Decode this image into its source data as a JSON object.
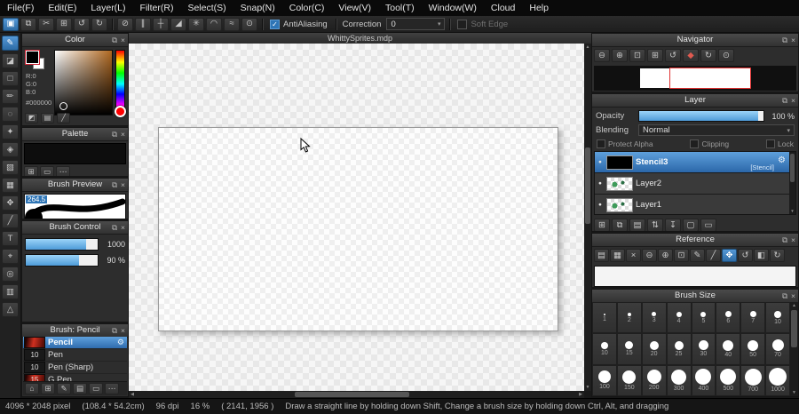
{
  "ui": {
    "popout": "⧉",
    "close": "×",
    "caret": "▾",
    "up": "▲",
    "down": "▼",
    "left": "◀",
    "right": "▶",
    "eye": "●",
    "gear": "⚙",
    "check": "✓",
    "dots": "⋯"
  },
  "colors": {
    "accent": "#2e75b6",
    "selection": "#3f87c9",
    "foreground": "#000000"
  },
  "menu_bar": {
    "items": [
      "File(F)",
      "Edit(E)",
      "Layer(L)",
      "Filter(R)",
      "Select(S)",
      "Snap(N)",
      "Color(C)",
      "View(V)",
      "Tool(T)",
      "Window(W)",
      "Cloud",
      "Help"
    ]
  },
  "top_toolbar": {
    "left_icons": [
      {
        "name": "selection-mode-icon",
        "glyph": "▣",
        "selected": true
      },
      {
        "name": "paste-icon",
        "glyph": "⧉"
      },
      {
        "name": "cut-icon",
        "glyph": "✂"
      },
      {
        "name": "copy-icon",
        "glyph": "⊞"
      },
      {
        "name": "undo-icon",
        "glyph": "↺"
      },
      {
        "name": "redo-icon",
        "glyph": "↻"
      }
    ],
    "snap_icons": [
      {
        "name": "snap-off-icon",
        "glyph": "⊘"
      },
      {
        "name": "snap-parallel-icon",
        "glyph": "∥"
      },
      {
        "name": "snap-crosshatch-icon",
        "glyph": "┼"
      },
      {
        "name": "snap-vanishing-point-icon",
        "glyph": "◢"
      },
      {
        "name": "snap-radial-icon",
        "glyph": "✳"
      },
      {
        "name": "snap-ellipse-icon",
        "glyph": "◠"
      },
      {
        "name": "snap-curve-icon",
        "glyph": "≈"
      },
      {
        "name": "snap-settings-icon",
        "glyph": "⊙"
      }
    ],
    "antialiasing_label": "AntiAliasing",
    "correction_label": "Correction",
    "correction_value": "0",
    "soft_edge_label": "Soft Edge"
  },
  "tool_strip": {
    "tools": [
      {
        "name": "brush-tool",
        "glyph": "✎",
        "selected": true
      },
      {
        "name": "eraser-tool",
        "glyph": "◪"
      },
      {
        "name": "select-rect-tool",
        "glyph": "□"
      },
      {
        "name": "select-pen-tool",
        "glyph": "✏"
      },
      {
        "name": "lasso-tool",
        "glyph": "◌"
      },
      {
        "name": "magic-wand-tool",
        "glyph": "✦"
      },
      {
        "name": "bucket-fill-tool",
        "glyph": "◈"
      },
      {
        "name": "gradient-tool",
        "glyph": "▨"
      },
      {
        "name": "pixel-grid-tool",
        "glyph": "▦"
      },
      {
        "name": "move-tool",
        "glyph": "✥"
      },
      {
        "name": "eyedropper-tool",
        "glyph": "╱"
      },
      {
        "name": "text-tool",
        "glyph": "T"
      },
      {
        "name": "pan-tool",
        "glyph": "⌖"
      },
      {
        "name": "zoom-tool",
        "glyph": "◎"
      },
      {
        "name": "divide-tool",
        "glyph": "▥"
      },
      {
        "name": "shape-tool",
        "glyph": "△"
      }
    ]
  },
  "document": {
    "title": "WhittySprites.mdp"
  },
  "panels": {
    "color": {
      "title": "Color",
      "r": "R:0",
      "g": "G:0",
      "b": "B:0",
      "hex": "#000000",
      "foot_icons": [
        {
          "name": "swatch-pair-icon",
          "glyph": "◩"
        },
        {
          "name": "slider-view-icon",
          "glyph": "▤"
        },
        {
          "name": "line-preview-icon",
          "glyph": "╱"
        }
      ]
    },
    "palette": {
      "title": "Palette",
      "toolbar_icons": [
        {
          "name": "add-color-icon",
          "glyph": "⊞"
        },
        {
          "name": "delete-color-icon",
          "glyph": "▭"
        },
        {
          "name": "more-icon",
          "glyph": "⋯"
        }
      ]
    },
    "brush_preview": {
      "title": "Brush Preview",
      "size_badge": "264.5"
    },
    "brush_control": {
      "title": "Brush Control",
      "size_value": "1000",
      "opacity_value": "90 %"
    },
    "brush_list": {
      "title": "Brush: Pencil",
      "brushes": [
        {
          "name": "Pencil",
          "size": "",
          "thumb": "red",
          "selected": true
        },
        {
          "name": "Pen",
          "size": "10",
          "thumb": "dark"
        },
        {
          "name": "Pen (Sharp)",
          "size": "10",
          "thumb": "dark"
        },
        {
          "name": "G Pen",
          "size": "15",
          "thumb": "red"
        }
      ],
      "toolbar_icons": [
        {
          "name": "home-icon",
          "glyph": "⌂"
        },
        {
          "name": "add-brush-icon",
          "glyph": "⊞"
        },
        {
          "name": "edit-brush-icon",
          "glyph": "✎"
        },
        {
          "name": "brush-folder-icon",
          "glyph": "▤"
        },
        {
          "name": "delete-brush-icon",
          "glyph": "▭"
        },
        {
          "name": "more-icon",
          "glyph": "⋯"
        }
      ]
    },
    "navigator": {
      "title": "Navigator",
      "icons": [
        {
          "name": "zoom-out-icon",
          "glyph": "⊖"
        },
        {
          "name": "zoom-in-icon",
          "glyph": "⊕"
        },
        {
          "name": "fit-window-icon",
          "glyph": "⊡"
        },
        {
          "name": "actual-size-icon",
          "glyph": "⊞"
        },
        {
          "name": "rotate-left-icon",
          "glyph": "↺"
        },
        {
          "name": "reset-rotation-icon",
          "glyph": "◆",
          "accent": "red"
        },
        {
          "name": "rotate-right-icon",
          "glyph": "↻"
        },
        {
          "name": "reset-view-icon",
          "glyph": "⊙"
        }
      ]
    },
    "layer": {
      "title": "Layer",
      "opacity_label": "Opacity",
      "opacity_value": "100 %",
      "blending_label": "Blending",
      "blending_value": "Normal",
      "checkboxes": [
        "Protect Alpha",
        "Clipping",
        "Lock"
      ],
      "layers": [
        {
          "name": "Stencil3",
          "tag": "[Stencil]",
          "thumb": "black",
          "selected": true
        },
        {
          "name": "Layer2",
          "tag": "",
          "thumb": "sprite"
        },
        {
          "name": "Layer1",
          "tag": "",
          "thumb": "sprite"
        }
      ],
      "toolbar_icons": [
        {
          "name": "add-layer-icon",
          "glyph": "⊞"
        },
        {
          "name": "duplicate-layer-icon",
          "glyph": "⧉"
        },
        {
          "name": "add-folder-icon",
          "glyph": "▤"
        },
        {
          "name": "move-layer-icon",
          "glyph": "⇅"
        },
        {
          "name": "merge-layer-icon",
          "glyph": "↧"
        },
        {
          "name": "clear-layer-icon",
          "glyph": "▢"
        },
        {
          "name": "delete-layer-icon",
          "glyph": "▭"
        }
      ]
    },
    "reference": {
      "title": "Reference",
      "icons": [
        {
          "name": "open-image-icon",
          "glyph": "▤"
        },
        {
          "name": "open-folder-icon",
          "glyph": "▦"
        },
        {
          "name": "clear-icon",
          "glyph": "×"
        },
        {
          "name": "zoom-out-icon",
          "glyph": "⊖"
        },
        {
          "name": "zoom-in-icon",
          "glyph": "⊕"
        },
        {
          "name": "fit-icon",
          "glyph": "⊡"
        },
        {
          "name": "pencil-icon",
          "glyph": "✎"
        },
        {
          "name": "eyedropper-icon",
          "glyph": "╱"
        },
        {
          "name": "hand-icon",
          "glyph": "✥",
          "selected": true
        },
        {
          "name": "rotate-left-icon",
          "glyph": "↺"
        },
        {
          "name": "flip-icon",
          "glyph": "◧"
        },
        {
          "name": "rotate-right-icon",
          "glyph": "↻"
        }
      ]
    },
    "brush_size": {
      "title": "Brush Size",
      "sizes": [
        1,
        2,
        3,
        4,
        5,
        6,
        7,
        10,
        10,
        15,
        20,
        25,
        30,
        40,
        50,
        70,
        100,
        150,
        200,
        300,
        400,
        500,
        700,
        1000
      ]
    }
  },
  "status_bar": {
    "dimensions": "4096 * 2048 pixel",
    "print_size": "(108.4 * 54.2cm)",
    "dpi": "96 dpi",
    "zoom": "16 %",
    "cursor_pos": "( 2141, 1956 )",
    "hint": "Draw a straight line by holding down Shift, Change a brush size by holding down Ctrl, Alt, and dragging"
  }
}
